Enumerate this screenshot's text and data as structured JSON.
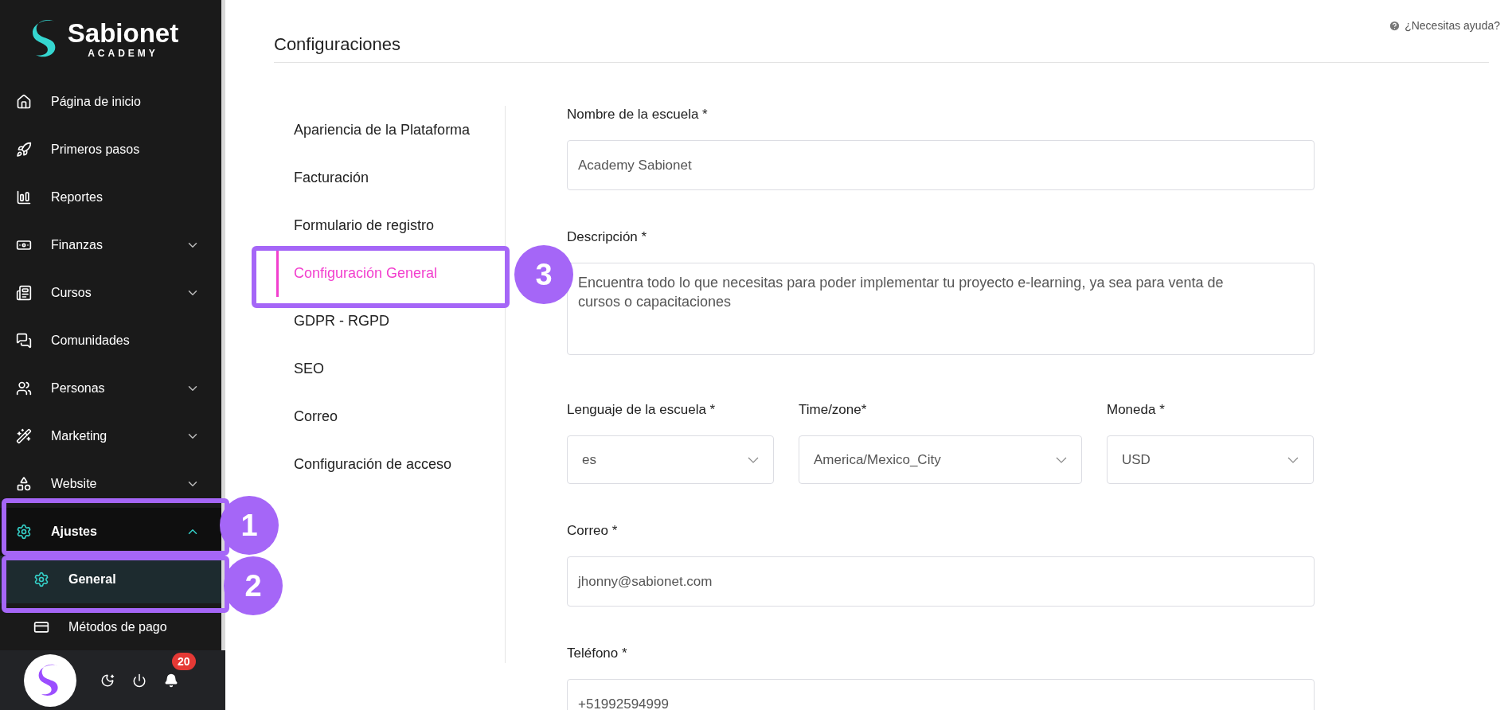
{
  "brand": {
    "name": "Sabionet",
    "tagline": "ACADEMY"
  },
  "sidebar": {
    "items": [
      {
        "label": "Página de inicio",
        "kind": "link"
      },
      {
        "label": "Primeros pasos",
        "kind": "link"
      },
      {
        "label": "Reportes",
        "kind": "link"
      },
      {
        "label": "Finanzas",
        "kind": "group",
        "expanded": false
      },
      {
        "label": "Cursos",
        "kind": "group",
        "expanded": false
      },
      {
        "label": "Comunidades",
        "kind": "link"
      },
      {
        "label": "Personas",
        "kind": "group",
        "expanded": false
      },
      {
        "label": "Marketing",
        "kind": "group",
        "expanded": false
      },
      {
        "label": "Website",
        "kind": "group",
        "expanded": false
      },
      {
        "label": "Ajustes",
        "kind": "group",
        "expanded": true,
        "annotation": "1",
        "children": [
          {
            "label": "General",
            "selected": true,
            "annotation": "2"
          },
          {
            "label": "Métodos de pago",
            "selected": false
          }
        ]
      }
    ]
  },
  "user_bar": {
    "notifications": "20"
  },
  "help_link": "¿Necesitas ayuda?",
  "page_title": "Configuraciones",
  "settings_nav": [
    {
      "label": "Apariencia de la Plataforma",
      "selected": false
    },
    {
      "label": "Facturación",
      "selected": false
    },
    {
      "label": "Formulario de registro",
      "selected": false
    },
    {
      "label": "Configuración General",
      "selected": true,
      "annotation": "3"
    },
    {
      "label": "GDPR - RGPD",
      "selected": false
    },
    {
      "label": "SEO",
      "selected": false
    },
    {
      "label": "Correo",
      "selected": false
    },
    {
      "label": "Configuración de acceso",
      "selected": false
    }
  ],
  "form": {
    "fields": [
      {
        "kind": "text",
        "label": "Nombre de la escuela *",
        "value": "Academy Sabionet"
      },
      {
        "kind": "textarea",
        "label": "Descripción *",
        "value": "Encuentra todo lo que necesitas para poder implementar tu proyecto e-learning, ya sea para venta de cursos o capacitaciones"
      },
      {
        "kind": "selects",
        "selects": [
          {
            "label": "Lenguaje de la escuela *",
            "value": "es"
          },
          {
            "label": "Time/zone*",
            "value": "America/Mexico_City"
          },
          {
            "label": "Moneda *",
            "value": "USD"
          }
        ]
      },
      {
        "kind": "text",
        "label": "Correo *",
        "value": "jhonny@sabionet.com"
      },
      {
        "kind": "text",
        "label": "Teléfono *",
        "value": "+51992594999"
      }
    ]
  }
}
